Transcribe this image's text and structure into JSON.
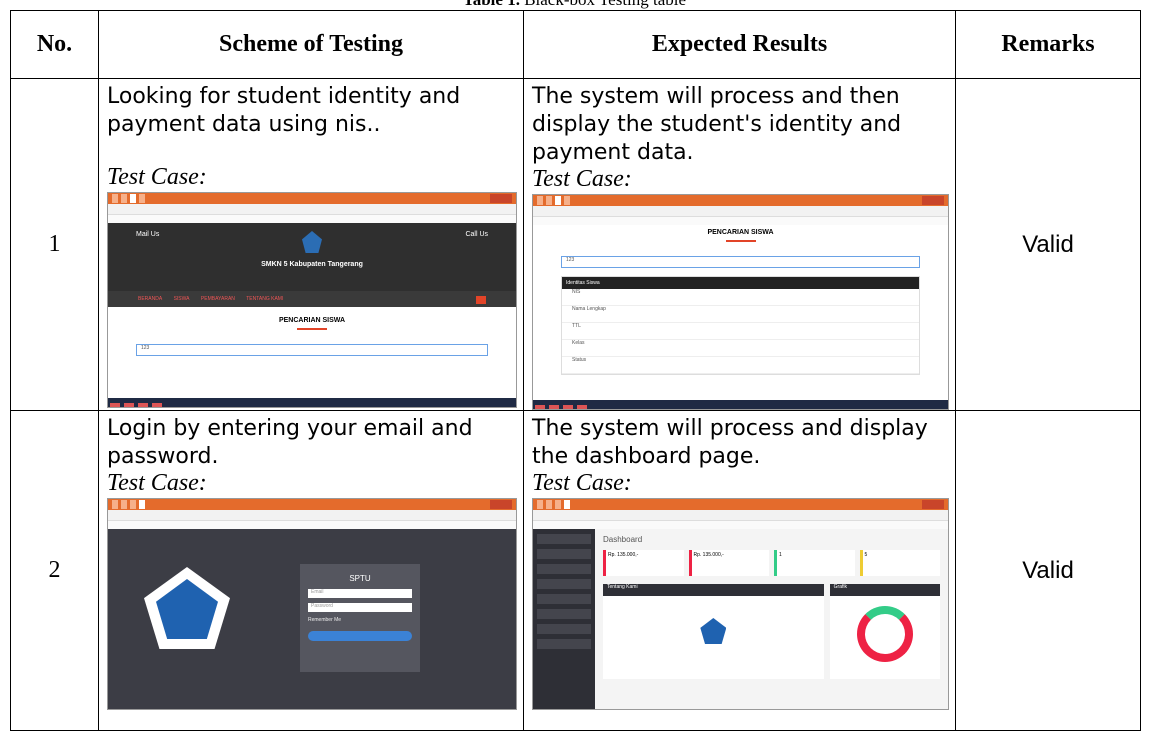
{
  "caption": {
    "label": "Table 1.",
    "text": "Black-box Testing table"
  },
  "headers": [
    "No.",
    "Scheme of Testing",
    "Expected Results",
    "Remarks"
  ],
  "rows": [
    {
      "no": "1",
      "scheme": "Looking for student identity and payment data using nis..",
      "expected": "The system will process and then display the student's identity and payment data.",
      "test_case_label": "Test Case:",
      "remarks": "Valid",
      "shot1": {
        "mail_title": "Mail Us",
        "call_title": "Call Us",
        "school": "SMKN 5 Kabupaten Tangerang",
        "menu": [
          "BERANDA",
          "SISWA",
          "PEMBAYARAN",
          "TENTANG KAMI"
        ],
        "section": "PENCARIAN SISWA",
        "nis_value": "123"
      },
      "shot2": {
        "section": "PENCARIAN SISWA",
        "nis_value": "123",
        "panel_title": "Identitas Siswa",
        "fields": [
          "NIS",
          "Nama Lengkap",
          "TTL",
          "Kelas",
          "Status"
        ]
      }
    },
    {
      "no": "2",
      "scheme": "Login by entering your email and password.",
      "expected": "The system will process and display the dashboard page.",
      "test_case_label": "Test Case:",
      "remarks": "Valid",
      "shot1": {
        "brand": "SPTU",
        "email_ph": "Email",
        "password_ph": "Password",
        "remember": "Remember Me"
      },
      "shot2": {
        "title": "Dashboard",
        "amount1": "Rp. 135.000,-",
        "amount2": "Rp. 135.000,-",
        "count1": "1",
        "count2": "5",
        "panel1": "Tentang Kami",
        "panel2": "Grafik"
      }
    }
  ]
}
